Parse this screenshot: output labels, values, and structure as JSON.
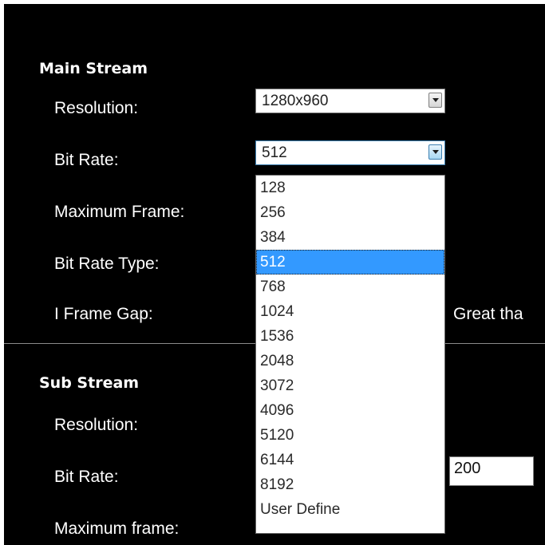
{
  "main_stream": {
    "title": "Main Stream",
    "resolution_label": "Resolution:",
    "resolution_value": "1280x960",
    "bit_rate_label": "Bit Rate:",
    "bit_rate_value": "512",
    "max_frame_label": "Maximum Frame:",
    "bit_rate_type_label": "Bit Rate Type:",
    "iframe_gap_label": "I Frame Gap:",
    "iframe_gap_note": "Great tha"
  },
  "sub_stream": {
    "title": "Sub Stream",
    "resolution_label": "Resolution:",
    "bit_rate_label": "Bit Rate:",
    "bit_rate_input": "200",
    "max_frame_label": "Maximum frame:"
  },
  "bit_rate_dropdown": {
    "selected": "512",
    "options": [
      "128",
      "256",
      "384",
      "512",
      "768",
      "1024",
      "1536",
      "2048",
      "3072",
      "4096",
      "5120",
      "6144",
      "8192",
      "User Define"
    ]
  },
  "colors": {
    "panel_background": "#000000",
    "selected_option": "#3399ff",
    "text": "#ffffff"
  },
  "icons": {
    "dropdown_arrow": "chevron-down-icon"
  }
}
